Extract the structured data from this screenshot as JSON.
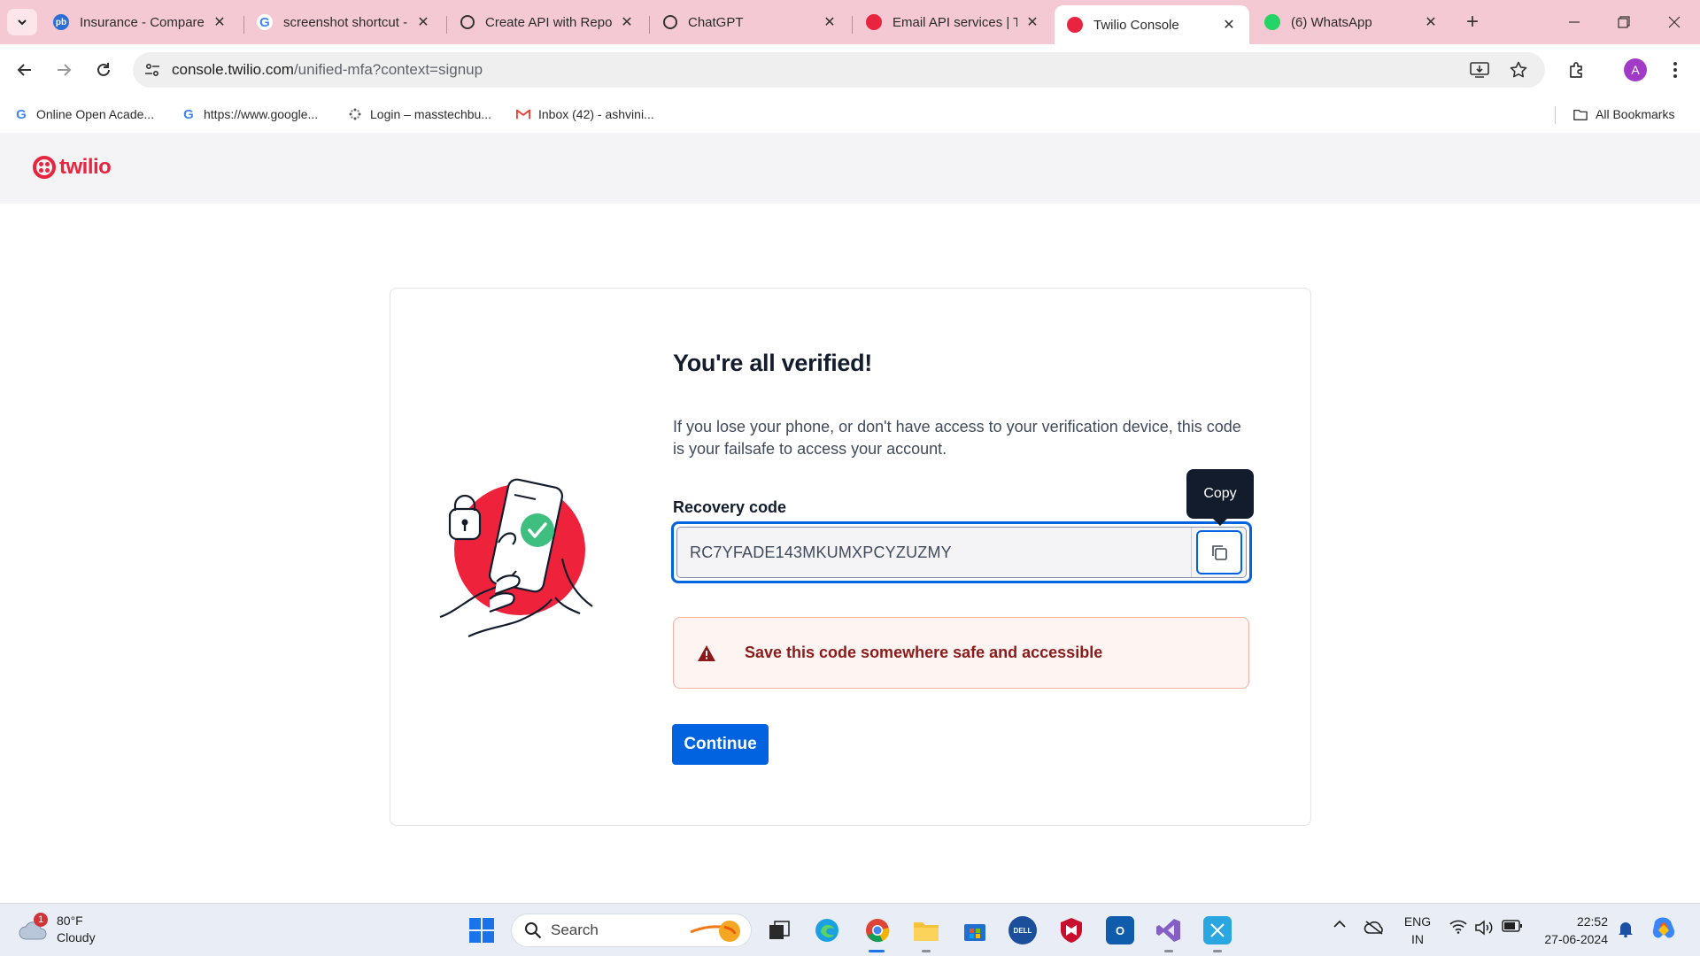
{
  "browser": {
    "tabs": [
      {
        "title": "Insurance - Compare",
        "favicon": "pb-icon",
        "active": false
      },
      {
        "title": "screenshot shortcut -",
        "favicon": "google-icon",
        "active": false
      },
      {
        "title": "Create API with Repo",
        "favicon": "chatgpt-icon",
        "active": false
      },
      {
        "title": "ChatGPT",
        "favicon": "chatgpt-icon",
        "active": false
      },
      {
        "title": "Email API services | T",
        "favicon": "twilio-icon",
        "active": false
      },
      {
        "title": "Twilio Console",
        "favicon": "twilio-icon",
        "active": true
      },
      {
        "title": "(6) WhatsApp",
        "favicon": "whatsapp-icon",
        "active": false
      }
    ],
    "url_host": "console.twilio.com",
    "url_path": "/unified-mfa?context=signup",
    "profile_initial": "A",
    "bookmarks": [
      {
        "label": "Online Open Acade...",
        "icon": "google-icon"
      },
      {
        "label": "https://www.google...",
        "icon": "google-icon"
      },
      {
        "label": "Login – masstechbu...",
        "icon": "slack-like-icon"
      },
      {
        "label": "Inbox (42) - ashvini...",
        "icon": "gmail-icon"
      }
    ],
    "all_bookmarks": "All Bookmarks"
  },
  "site": {
    "logo_text": "twilio",
    "brand_color": "#e8243f"
  },
  "verify": {
    "heading": "You're all verified!",
    "description": "If you lose your phone, or don't have access to your verification device, this code is your failsafe to access your account.",
    "recovery_label": "Recovery code",
    "recovery_code": "RC7YFADE143MKUMXPCYZUZMY",
    "copy_tooltip": "Copy",
    "warning": "Save this code somewhere safe and accessible",
    "continue_label": "Continue",
    "accent_color": "#0263e0"
  },
  "taskbar": {
    "weather_temp": "80°F",
    "weather_desc": "Cloudy",
    "weather_badge": "1",
    "search_label": "Search",
    "lang_top": "ENG",
    "lang_bottom": "IN",
    "time": "22:52",
    "date": "27-06-2024"
  }
}
